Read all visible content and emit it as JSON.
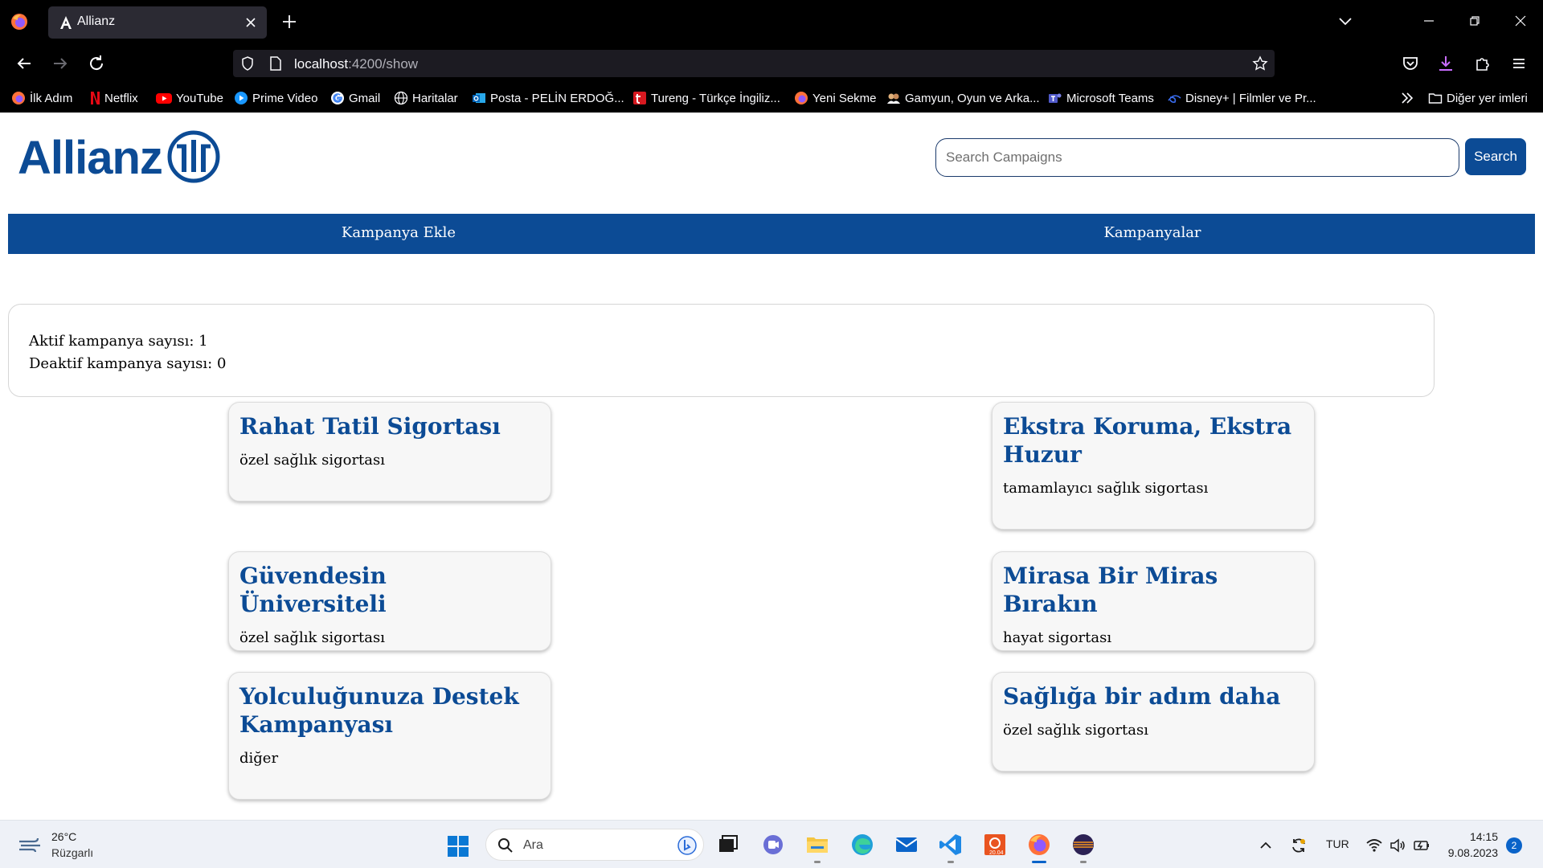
{
  "browser": {
    "tab_title": "Allianz",
    "url_host": "localhost",
    "url_path": ":4200/show",
    "bookmarks": [
      {
        "label": "İlk Adım",
        "icon": "firefox-icon"
      },
      {
        "label": "Netflix",
        "icon": "netflix-icon"
      },
      {
        "label": "YouTube",
        "icon": "youtube-icon"
      },
      {
        "label": "Prime Video",
        "icon": "prime-video-icon"
      },
      {
        "label": "Gmail",
        "icon": "google-icon"
      },
      {
        "label": "Haritalar",
        "icon": "globe-icon"
      },
      {
        "label": "Posta - PELİN ERDOĞ...",
        "icon": "outlook-icon"
      },
      {
        "label": "Tureng - Türkçe İngiliz...",
        "icon": "tureng-icon"
      },
      {
        "label": "Yeni Sekme",
        "icon": "firefox-icon"
      },
      {
        "label": "Gamyun, Oyun ve Arka...",
        "icon": "gamyun-icon"
      },
      {
        "label": "Microsoft Teams",
        "icon": "teams-icon"
      },
      {
        "label": "Disney+ | Filmler ve Pr...",
        "icon": "disney-icon"
      }
    ],
    "other_bookmarks": "Diğer yer imleri"
  },
  "header": {
    "logo_text": "Allianz",
    "search_placeholder": "Search Campaigns",
    "search_button": "Search"
  },
  "menu": {
    "items": [
      "Kampanya Ekle",
      "Kampanyalar"
    ]
  },
  "stats": {
    "active": "Aktif kampanya sayısı: 1",
    "inactive": "Deaktif kampanya sayısı: 0"
  },
  "campaigns": [
    {
      "title": "Rahat Tatil Sigortası",
      "category": "özel sağlık sigortası"
    },
    {
      "title": "Ekstra Koruma, Ekstra Huzur",
      "category": "tamamlayıcı sağlık sigortası"
    },
    {
      "title": "Güvendesin Üniversiteli",
      "category": "özel sağlık sigortası"
    },
    {
      "title": "Mirasa Bir Miras Bırakın",
      "category": "hayat sigortası"
    },
    {
      "title": "Yolculuğunuza Destek Kampanyası",
      "category": "diğer"
    },
    {
      "title": "Sağlığa bir adım daha",
      "category": "özel sağlık sigortası"
    }
  ],
  "taskbar": {
    "weather_temp": "26°C",
    "weather_desc": "Rüzgarlı",
    "search_placeholder": "Ara",
    "language": "TUR",
    "time": "14:15",
    "date": "9.08.2023",
    "notification_count": "2"
  },
  "colors": {
    "brand_blue": "#0c4b95",
    "chrome_bg": "#000000",
    "card_bg": "#f7f7f7"
  }
}
